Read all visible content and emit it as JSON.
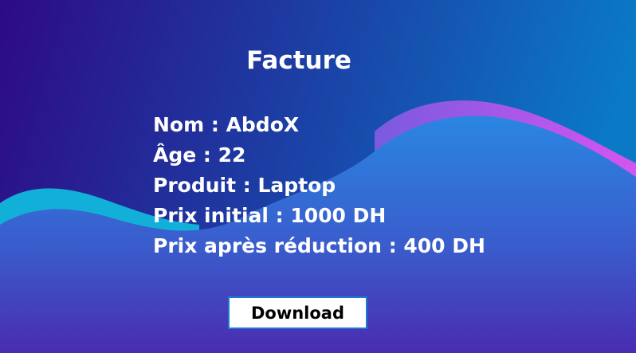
{
  "invoice": {
    "title": "Facture",
    "lines": [
      {
        "label": "Nom",
        "value": "AbdoX"
      },
      {
        "label": "Âge",
        "value": "22"
      },
      {
        "label": "Produit",
        "value": "Laptop"
      },
      {
        "label": "Prix initial",
        "value": "1000 DH"
      },
      {
        "label": "Prix après réduction",
        "value": "400 DH"
      }
    ]
  },
  "actions": {
    "download_label": "Download"
  },
  "colors": {
    "bg_left": "#2e0a86",
    "bg_right": "#0a7ac6",
    "wave_fill": "#2a86e2",
    "wave_bottom": "#4a2cb0",
    "cyan_ribbon": "#12b0d8",
    "magenta_ribbon": "#cc58ee"
  }
}
